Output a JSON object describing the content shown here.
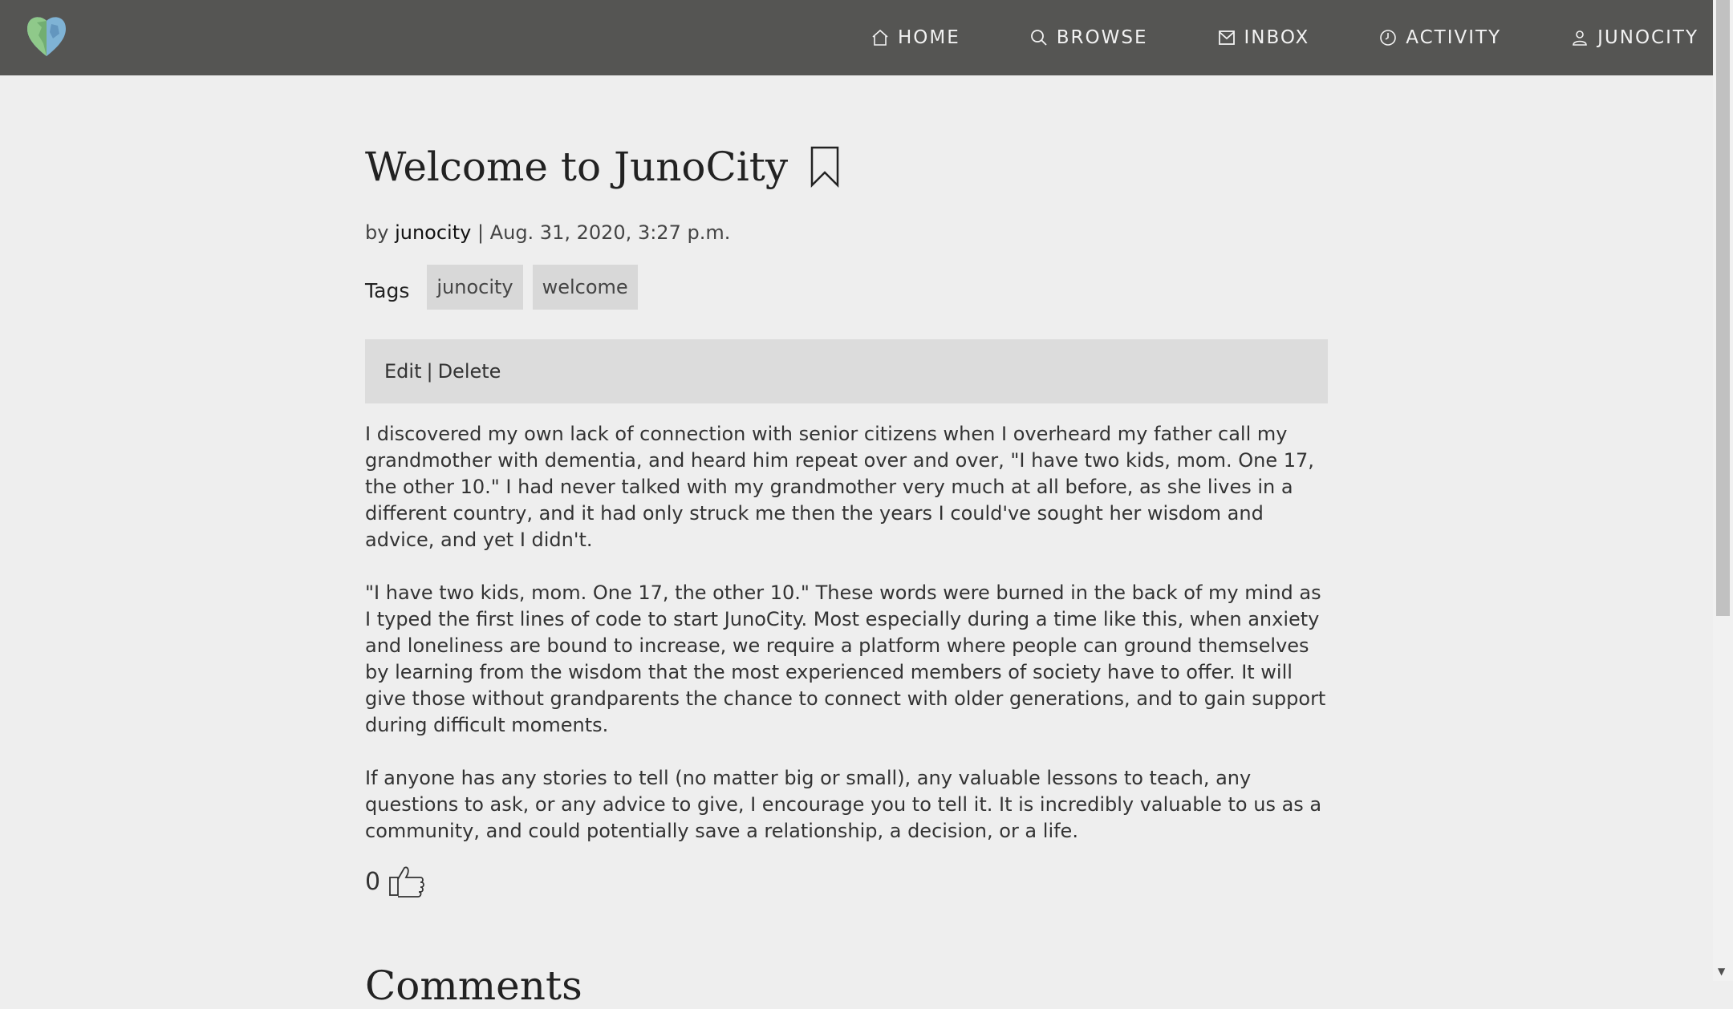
{
  "nav": {
    "items": [
      {
        "label": "HOME",
        "icon": "home-icon"
      },
      {
        "label": "BROWSE",
        "icon": "search-icon"
      },
      {
        "label": "INBOX",
        "icon": "mail-icon"
      },
      {
        "label": "ACTIVITY",
        "icon": "clock-icon"
      },
      {
        "label": "JUNOCITY",
        "icon": "user-icon"
      }
    ]
  },
  "post": {
    "title": "Welcome to JunoCity",
    "by_prefix": "by",
    "author": "junocity",
    "date": "| Aug. 31, 2020, 3:27 p.m.",
    "tags_label": "Tags",
    "tags": [
      "junocity",
      "welcome"
    ],
    "edit_label": "Edit",
    "separator": "|",
    "delete_label": "Delete",
    "paragraphs": [
      "I discovered my own lack of connection with senior citizens when I overheard my father call my grandmother with dementia, and heard him repeat over and over, \"I have two kids, mom. One 17, the other 10.\" I had never talked with my grandmother very much at all before, as she lives in a different country, and it had only struck me then the years I could've sought her wisdom and advice, and yet I didn't.",
      "\"I have two kids, mom. One 17, the other 10.\" These words were burned in the back of my mind as I typed the first lines of code to start JunoCity. Most especially during a time like this, when anxiety and loneliness are bound to increase, we require a platform where people can ground themselves by learning from the wisdom that the most experienced members of society have to offer. It will give those without grandparents the chance to connect with older generations, and to gain support during difficult moments.",
      "If anyone has any stories to tell (no matter big or small), any valuable lessons to teach, any questions to ask, or any advice to give, I encourage you to tell it. It is incredibly valuable to us as a community, and could potentially save a relationship, a decision, or a life."
    ],
    "likes": "0"
  },
  "comments": {
    "title": "Comments"
  },
  "colors": {
    "navbar": "#555553",
    "background": "#eeeeee",
    "tag_bg": "#d8d8d8",
    "edit_bar_bg": "#dcdcdc"
  }
}
